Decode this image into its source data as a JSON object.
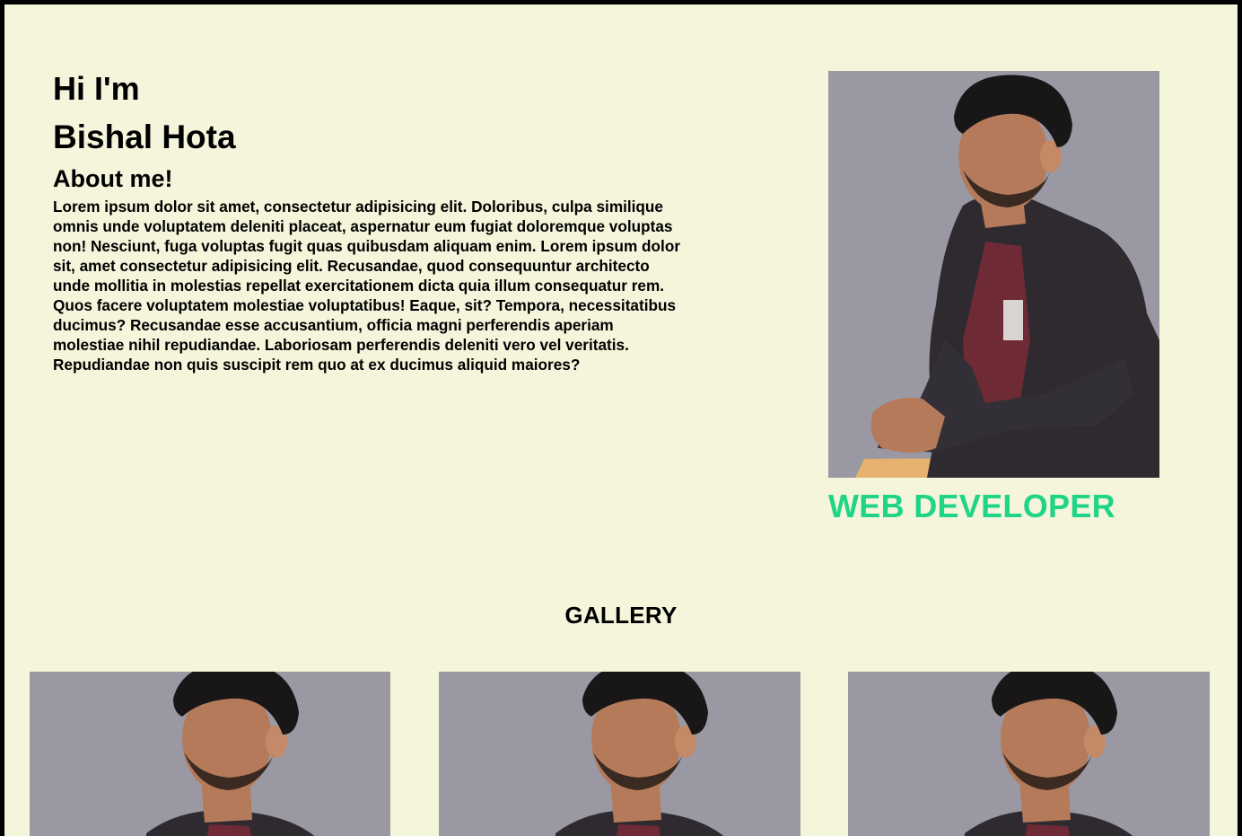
{
  "hero": {
    "greeting": "Hi I'm",
    "name": "Bishal Hota",
    "about_title": "About me!",
    "about_text": "Lorem ipsum dolor sit amet, consectetur adipisicing elit. Doloribus, culpa similique omnis unde voluptatem deleniti placeat, aspernatur eum fugiat doloremque voluptas non! Nesciunt, fuga voluptas fugit quas quibusdam aliquam enim. Lorem ipsum dolor sit, amet consectetur adipisicing elit. Recusandae, quod consequuntur architecto unde mollitia in molestias repellat exercitationem dicta quia illum consequatur rem. Quos facere voluptatem molestiae voluptatibus! Eaque, sit? Tempora, necessitatibus ducimus? Recusandae esse accusantium, officia magni perferendis aperiam molestiae nihil repudiandae. Laboriosam perferendis deleniti vero vel veritatis. Repudiandae non quis suscipit rem quo at ex ducimus aliquid maiores?",
    "role": "WEB DEVELOPER"
  },
  "gallery": {
    "title": "GALLERY",
    "photo_count": 3
  },
  "colors": {
    "page_background": "#f5f5dc",
    "frame": "#000000",
    "role_accent": "#20d487",
    "photo_backdrop": "#9a99a3"
  }
}
